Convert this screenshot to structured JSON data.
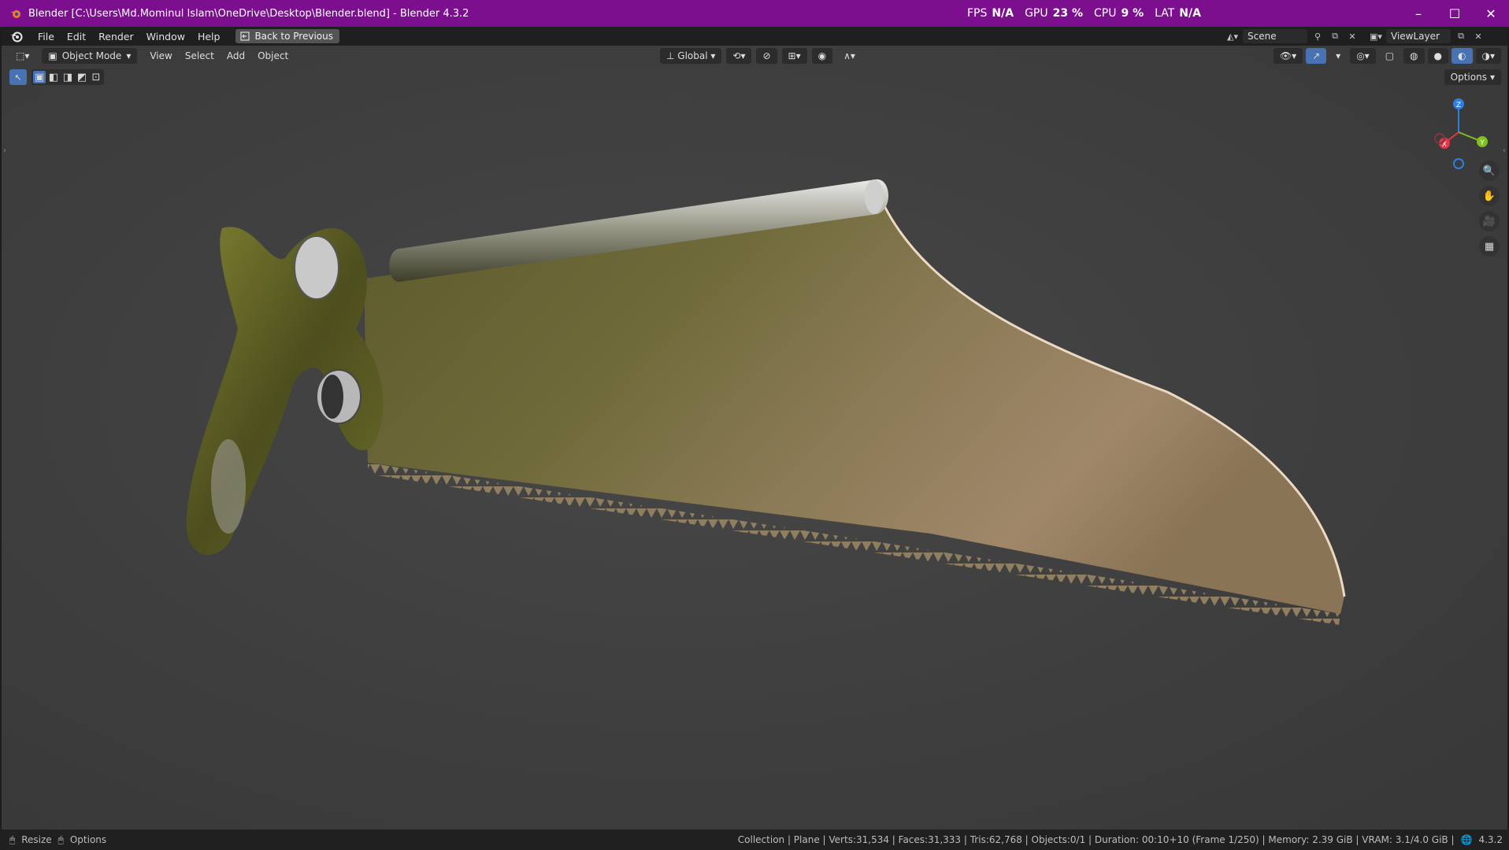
{
  "window": {
    "title": "Blender [C:\\Users\\Md.Mominul Islam\\OneDrive\\Desktop\\Blender.blend] - Blender 4.3.2",
    "stats": [
      {
        "label": "FPS",
        "value": "N/A"
      },
      {
        "label": "GPU",
        "value": "23 %"
      },
      {
        "label": "CPU",
        "value": "9 %"
      },
      {
        "label": "LAT",
        "value": "N/A"
      }
    ],
    "controls": {
      "minimize": "–",
      "maximize": "☐",
      "close": "✕"
    }
  },
  "menubar": {
    "items": [
      "File",
      "Edit",
      "Render",
      "Window",
      "Help"
    ],
    "back_button": "Back to Previous",
    "scene": "Scene",
    "view_layer": "ViewLayer"
  },
  "viewport_header": {
    "mode": "Object Mode",
    "menus": [
      "View",
      "Select",
      "Add",
      "Object"
    ],
    "transform_orientation": "Global",
    "options": "Options"
  },
  "gizmo": {
    "x": "X",
    "y": "Y",
    "z": "Z"
  },
  "statusbar": {
    "left": [
      {
        "label": "Resize",
        "icon": "mouse-left-icon"
      },
      {
        "label": "Options",
        "icon": "mouse-right-icon"
      }
    ],
    "info": "Collection | Plane | Verts:31,534 | Faces:31,333 | Tris:62,768 | Objects:0/1 | Duration: 00:10+10 (Frame 1/250) | Memory: 2.39 GiB | VRAM: 3.1/4.0 GiB |",
    "version": "4.3.2"
  },
  "colors": {
    "titlebar": "#7b0f8d",
    "viewport": "#3d3d3d",
    "accent": "#4772b3",
    "axis_x": "#e3354b",
    "axis_y": "#7fbf1f",
    "axis_z": "#2f7fe0"
  }
}
